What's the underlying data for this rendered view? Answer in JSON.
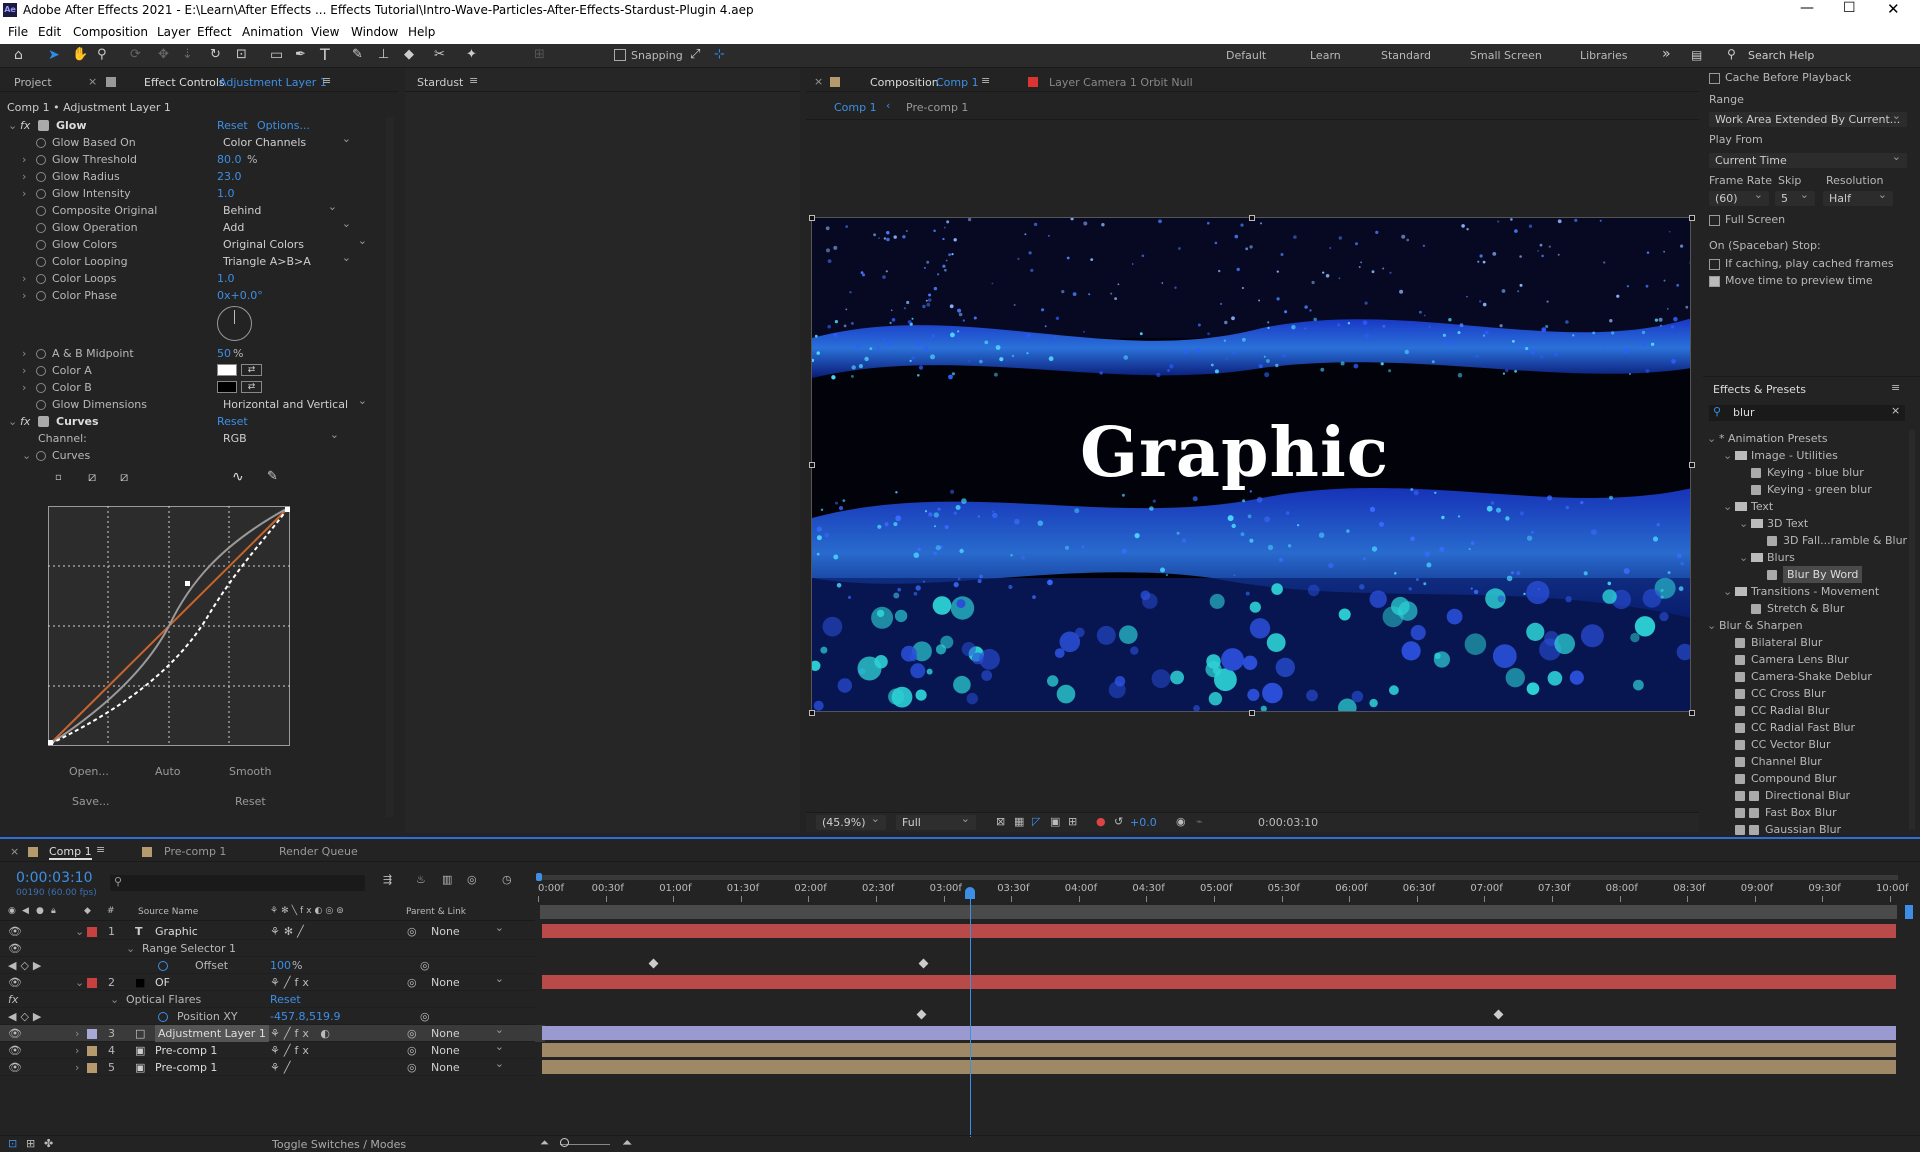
{
  "app": {
    "logo": "Ae",
    "title": "Adobe After Effects 2021 - E:\\Learn\\After Effects ... Effects Tutorial\\Intro-Wave-Particles-After-Effects-Stardust-Plugin 4.aep"
  },
  "menu": [
    "File",
    "Edit",
    "Composition",
    "Layer",
    "Effect",
    "Animation",
    "View",
    "Window",
    "Help"
  ],
  "toolbar": {
    "snapping": "Snapping",
    "workspaces": [
      "Default",
      "Learn",
      "Standard",
      "Small Screen",
      "Libraries"
    ],
    "search": "Search Help"
  },
  "effect_controls": {
    "tab_project": "Project",
    "tab_label": "Effect Controls",
    "tab_layer": "Adjustment Layer 1",
    "breadcrumb": "Comp 1 • Adjustment Layer 1",
    "glow": {
      "name": "Glow",
      "reset": "Reset",
      "options": "Options...",
      "props": [
        {
          "label": "Glow Based On",
          "value": "Color Channels",
          "kind": "dropdown"
        },
        {
          "label": "Glow Threshold",
          "value": "80.0",
          "unit": "%",
          "kind": "value"
        },
        {
          "label": "Glow Radius",
          "value": "23.0",
          "kind": "value"
        },
        {
          "label": "Glow Intensity",
          "value": "1.0",
          "kind": "value"
        },
        {
          "label": "Composite Original",
          "value": "Behind",
          "kind": "dropdown"
        },
        {
          "label": "Glow Operation",
          "value": "Add",
          "kind": "dropdown"
        },
        {
          "label": "Glow Colors",
          "value": "Original Colors",
          "kind": "dropdown"
        },
        {
          "label": "Color Looping",
          "value": "Triangle A>B>A",
          "kind": "dropdown"
        },
        {
          "label": "Color Loops",
          "value": "1.0",
          "kind": "value"
        },
        {
          "label": "Color Phase",
          "value": "0x+0.0°",
          "kind": "value"
        }
      ],
      "props2": [
        {
          "label": "A & B Midpoint",
          "value": "50",
          "unit": "%",
          "kind": "value"
        },
        {
          "label": "Color A",
          "value": "#ffffff",
          "kind": "color"
        },
        {
          "label": "Color B",
          "value": "#000000",
          "kind": "color"
        },
        {
          "label": "Glow Dimensions",
          "value": "Horizontal and Vertical",
          "kind": "dropdown"
        }
      ]
    },
    "curves": {
      "name": "Curves",
      "reset": "Reset",
      "channel_label": "Channel:",
      "channel": "RGB",
      "sub": "Curves",
      "buttons": {
        "open": "Open...",
        "auto": "Auto",
        "smooth": "Smooth",
        "save": "Save...",
        "reset": "Reset"
      }
    }
  },
  "stardust": {
    "tab": "Stardust"
  },
  "composition": {
    "tab_label": "Composition",
    "tab_comp": "Comp 1",
    "layer_tab": "Layer  Camera 1 Orbit Null",
    "crumb1": "Comp 1",
    "crumb2": "Pre-comp 1",
    "title_text": "Graphic",
    "footer": {
      "zoom": "(45.9%)",
      "quality": "Full",
      "exposure": "+0.0",
      "time": "0:00:03:10"
    }
  },
  "preview": {
    "cache": "Cache Before Playback",
    "range_label": "Range",
    "range": "Work Area Extended By Current...",
    "play_from_label": "Play From",
    "play_from": "Current Time",
    "frame_rate_label": "Frame Rate",
    "skip_label": "Skip",
    "resolution_label": "Resolution",
    "frame_rate": "(60)",
    "skip": "5",
    "resolution": "Half",
    "full_screen": "Full Screen",
    "spacebar": "On (Spacebar) Stop:",
    "if_caching": "If caching, play cached frames",
    "move_time": "Move time to preview time"
  },
  "effects_presets": {
    "title": "Effects & Presets",
    "search": "blur",
    "tree": [
      {
        "label": "* Animation Presets",
        "level": 0,
        "icon": "none",
        "exp": true
      },
      {
        "label": "Image - Utilities",
        "level": 1,
        "icon": "folder",
        "exp": true
      },
      {
        "label": "Keying - blue blur",
        "level": 2,
        "icon": "preset"
      },
      {
        "label": "Keying - green blur",
        "level": 2,
        "icon": "preset"
      },
      {
        "label": "Text",
        "level": 1,
        "icon": "folder",
        "exp": true
      },
      {
        "label": "3D Text",
        "level": 2,
        "icon": "folder",
        "exp": true
      },
      {
        "label": "3D Fall...ramble & Blur",
        "level": 3,
        "icon": "preset"
      },
      {
        "label": "Blurs",
        "level": 2,
        "icon": "folder",
        "exp": true
      },
      {
        "label": "Blur By Word",
        "level": 3,
        "icon": "preset",
        "selected": true
      },
      {
        "label": "Transitions - Movement",
        "level": 1,
        "icon": "folder",
        "exp": true
      },
      {
        "label": "Stretch & Blur",
        "level": 2,
        "icon": "preset"
      },
      {
        "label": "Blur & Sharpen",
        "level": 0,
        "icon": "none",
        "exp": true
      },
      {
        "label": "Bilateral Blur",
        "level": 1,
        "icon": "effect"
      },
      {
        "label": "Camera Lens Blur",
        "level": 1,
        "icon": "effect"
      },
      {
        "label": "Camera-Shake Deblur",
        "level": 1,
        "icon": "effect"
      },
      {
        "label": "CC Cross Blur",
        "level": 1,
        "icon": "effect"
      },
      {
        "label": "CC Radial Blur",
        "level": 1,
        "icon": "effect"
      },
      {
        "label": "CC Radial Fast Blur",
        "level": 1,
        "icon": "effect"
      },
      {
        "label": "CC Vector Blur",
        "level": 1,
        "icon": "effect"
      },
      {
        "label": "Channel Blur",
        "level": 1,
        "icon": "effect"
      },
      {
        "label": "Compound Blur",
        "level": 1,
        "icon": "effect"
      },
      {
        "label": "Directional Blur",
        "level": 1,
        "icon": "effect2"
      },
      {
        "label": "Fast Box Blur",
        "level": 1,
        "icon": "effect2"
      },
      {
        "label": "Gaussian Blur",
        "level": 1,
        "icon": "effect2"
      }
    ]
  },
  "timeline": {
    "tabs": [
      "Comp 1",
      "Pre-comp 1",
      "Render Queue"
    ],
    "time": "0:00:03:10",
    "fps": "00190 (60.00 fps)",
    "col_source": "Source Name",
    "col_parent": "Parent & Link",
    "toggle": "Toggle Switches / Modes",
    "ruler": [
      "0:00f",
      "00:30f",
      "01:00f",
      "01:30f",
      "02:00f",
      "02:30f",
      "03:00f",
      "03:30f",
      "04:00f",
      "04:30f",
      "05:00f",
      "05:30f",
      "06:00f",
      "06:30f",
      "07:00f",
      "07:30f",
      "08:00f",
      "08:30f",
      "09:00f",
      "09:30f",
      "10:00f"
    ],
    "rows": [
      {
        "num": "1",
        "name": "Graphic",
        "type": "T",
        "color": "#c84040",
        "parent": "None",
        "kind": "layer",
        "bar": "red"
      },
      {
        "name": "Range Selector 1",
        "kind": "sub",
        "indent": 1
      },
      {
        "name": "Offset",
        "value": "100",
        "unit": "%",
        "kind": "prop"
      },
      {
        "num": "2",
        "name": "OF",
        "type": "solid",
        "color": "#c84040",
        "parent": "None",
        "kind": "layer",
        "bar": "red"
      },
      {
        "name": "Optical Flares",
        "reset": "Reset",
        "kind": "sub",
        "indent": 1
      },
      {
        "name": "Position XY",
        "value": "-457.8,519.9",
        "kind": "prop"
      },
      {
        "num": "3",
        "name": "Adjustment Layer 1",
        "type": "adj",
        "color": "#a9a9d8",
        "parent": "None",
        "kind": "layer",
        "bar": "lav",
        "selected": true
      },
      {
        "num": "4",
        "name": "Pre-comp 1",
        "type": "comp",
        "color": "#b59a6d",
        "parent": "None",
        "kind": "layer",
        "bar": "tan"
      },
      {
        "num": "5",
        "name": "Pre-comp 1",
        "type": "comp",
        "color": "#b59a6d",
        "parent": "None",
        "kind": "layer",
        "bar": "tan"
      }
    ]
  }
}
